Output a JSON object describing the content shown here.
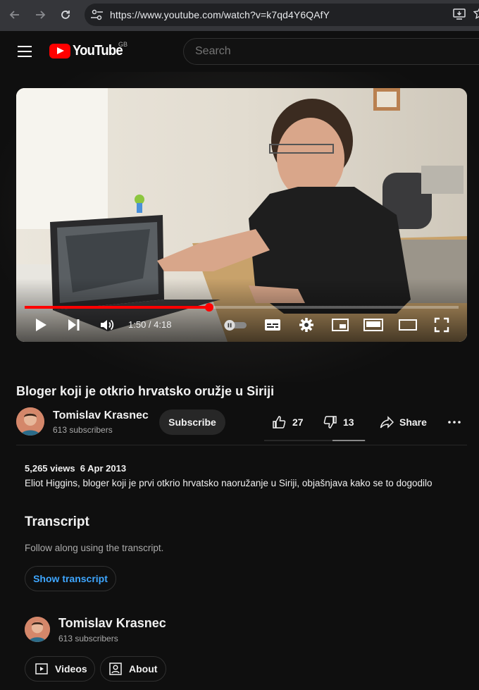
{
  "browser": {
    "url": "https://www.youtube.com/watch?v=k7qd4Y6QAfY"
  },
  "header": {
    "logo_text": "YouTube",
    "region": "GB",
    "search_placeholder": "Search"
  },
  "player": {
    "current_time": "1:50",
    "duration": "4:18",
    "time_display": "1:50 / 4:18",
    "progress_fraction": 0.426,
    "accent_color": "#ff0000"
  },
  "video": {
    "title": "Bloger koji je otkrio hrvatsko oružje u Siriji",
    "channel_name": "Tomislav Krasnec",
    "subscribers": "613 subscribers",
    "subscribe_label": "Subscribe",
    "likes": "27",
    "dislikes": "13",
    "share_label": "Share"
  },
  "description": {
    "views_date": "5,265 views  6 Apr 2013",
    "text": "Eliot Higgins, bloger koji je prvi otkrio hrvatsko naoružanje u Siriji, objašnjava kako se to dogodilo"
  },
  "transcript": {
    "heading": "Transcript",
    "subtitle": "Follow along using the transcript.",
    "button_label": "Show transcript"
  },
  "channel_card": {
    "name": "Tomislav Krasnec",
    "subscribers": "613 subscribers",
    "videos_label": "Videos",
    "about_label": "About"
  }
}
